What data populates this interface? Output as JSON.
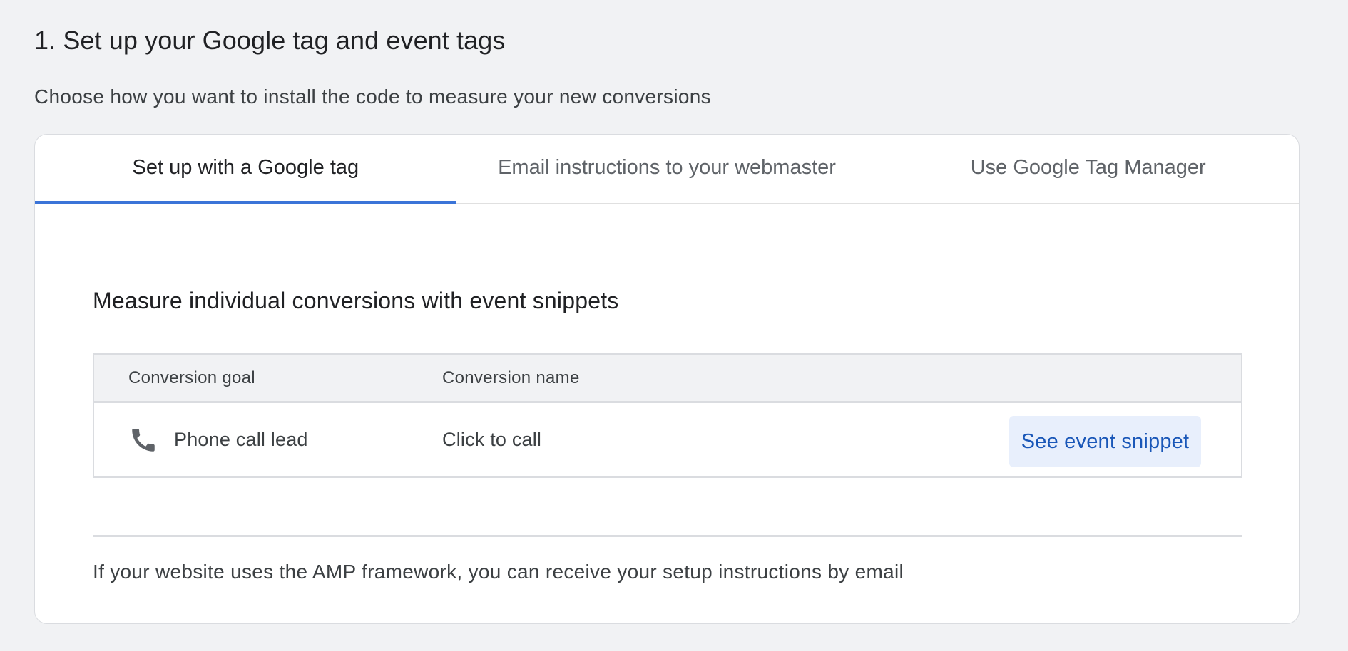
{
  "section": {
    "title": "1. Set up your Google tag and event tags",
    "subtitle": "Choose how you want to install the code to measure your new conversions"
  },
  "tabs": [
    {
      "label": "Set up with a Google tag",
      "active": true
    },
    {
      "label": "Email instructions to your webmaster",
      "active": false
    },
    {
      "label": "Use Google Tag Manager",
      "active": false
    }
  ],
  "event_snippets": {
    "heading": "Measure individual conversions with event snippets",
    "columns": {
      "goal": "Conversion goal",
      "name": "Conversion name"
    },
    "rows": [
      {
        "goal": "Phone call lead",
        "goal_icon": "phone-icon",
        "name": "Click to call",
        "action_label": "See event snippet"
      }
    ]
  },
  "footer": {
    "note": "If your website uses the AMP framework, you can receive your setup instructions by email"
  },
  "colors": {
    "accent": "#3b74d8",
    "button_text": "#1a57b8",
    "button_bg": "#e8effc",
    "icon": "#5f6368"
  }
}
